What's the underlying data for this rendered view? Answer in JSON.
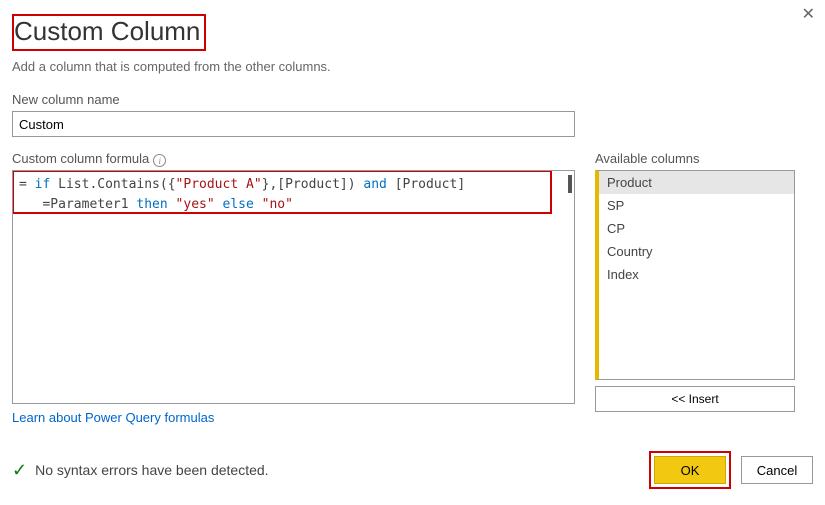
{
  "title": "Custom Column",
  "subtitle": "Add a column that is computed from the other columns.",
  "close": "✕",
  "new_col_label": "New column name",
  "new_col_value": "Custom",
  "formula_label": "Custom column formula",
  "formula": {
    "eq": "= ",
    "if": "if",
    "p1": " List.Contains({",
    "s1": "\"Product A\"",
    "p2": "},[Product]) ",
    "and": "and",
    "p3": " [Product]",
    "line2a": "   =Parameter1 ",
    "then": "then",
    "sp1": " ",
    "s2": "\"yes\"",
    "sp2": " ",
    "else": "else",
    "sp3": " ",
    "s3": "\"no\""
  },
  "avail_label": "Available columns",
  "avail_items": [
    "Product",
    "SP",
    "CP",
    "Country",
    "Index"
  ],
  "insert_label": "<< Insert",
  "link_text": "Learn about Power Query formulas",
  "status_text": "No syntax errors have been detected.",
  "ok_label": "OK",
  "cancel_label": "Cancel"
}
